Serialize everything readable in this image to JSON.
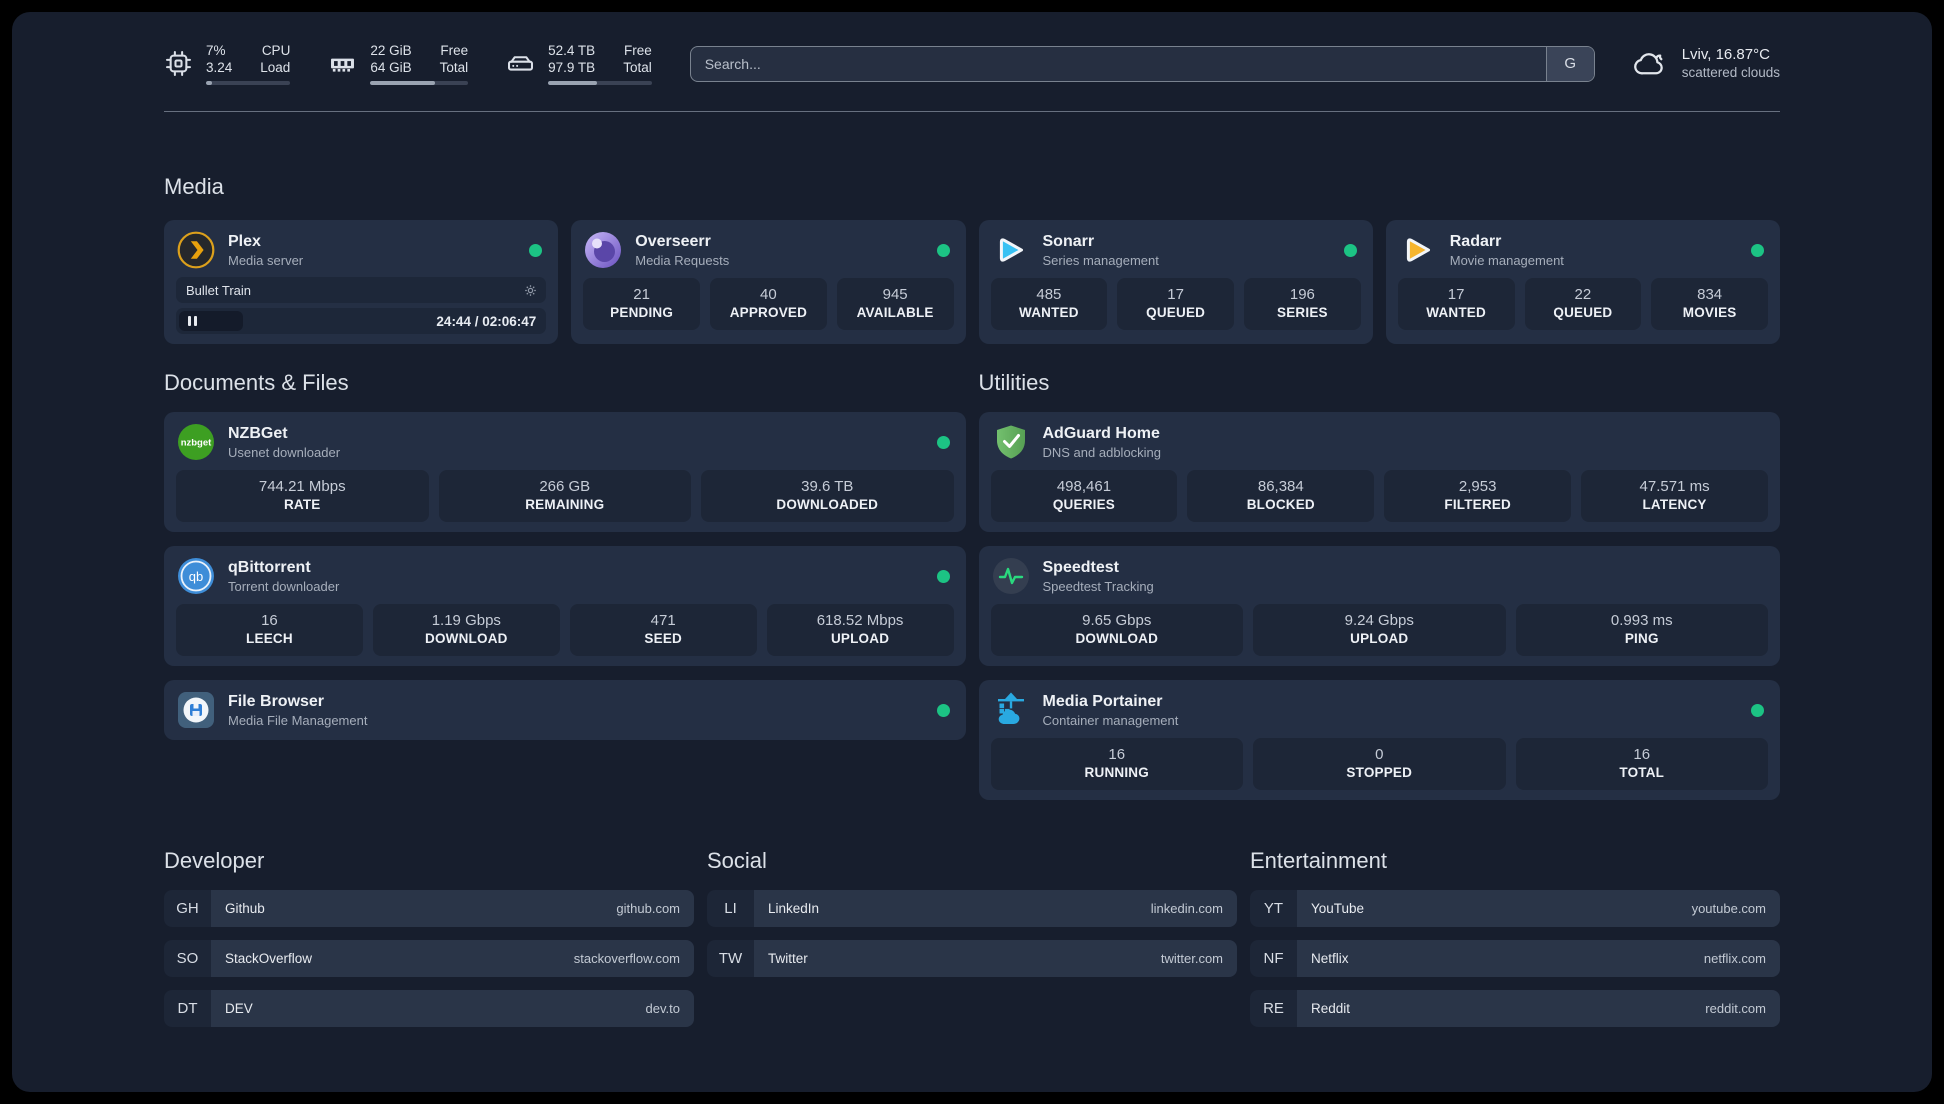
{
  "topbar": {
    "widgets": [
      {
        "icon": "cpu-icon",
        "value_top": "7%",
        "value_bottom": "3.24",
        "label_top": "CPU",
        "label_bottom": "Load",
        "progress": 7
      },
      {
        "icon": "memory-icon",
        "value_top": "22 GiB",
        "value_bottom": "64 GiB",
        "label_top": "Free",
        "label_bottom": "Total",
        "progress": 66
      },
      {
        "icon": "disk-icon",
        "value_top": "52.4 TB",
        "value_bottom": "97.9 TB",
        "label_top": "Free",
        "label_bottom": "Total",
        "progress": 47
      }
    ],
    "search": {
      "placeholder": "Search...",
      "button_label": "G"
    },
    "weather": {
      "icon": "cloud-icon",
      "location": "Lviv, 16.87°C",
      "condition": "scattered clouds"
    }
  },
  "media": {
    "heading": "Media",
    "plex": {
      "title": "Plex",
      "subtitle": "Media server",
      "status": "online",
      "now_playing": "Bullet Train",
      "time": "24:44 / 02:06:47"
    },
    "overseerr": {
      "title": "Overseerr",
      "subtitle": "Media Requests",
      "status": "online",
      "stats": [
        {
          "value": "21",
          "label": "PENDING"
        },
        {
          "value": "40",
          "label": "APPROVED"
        },
        {
          "value": "945",
          "label": "AVAILABLE"
        }
      ]
    },
    "sonarr": {
      "title": "Sonarr",
      "subtitle": "Series management",
      "status": "online",
      "stats": [
        {
          "value": "485",
          "label": "WANTED"
        },
        {
          "value": "17",
          "label": "QUEUED"
        },
        {
          "value": "196",
          "label": "SERIES"
        }
      ]
    },
    "radarr": {
      "title": "Radarr",
      "subtitle": "Movie management",
      "status": "online",
      "stats": [
        {
          "value": "17",
          "label": "WANTED"
        },
        {
          "value": "22",
          "label": "QUEUED"
        },
        {
          "value": "834",
          "label": "MOVIES"
        }
      ]
    }
  },
  "documents": {
    "heading": "Documents & Files",
    "nzbget": {
      "title": "NZBGet",
      "subtitle": "Usenet downloader",
      "status": "online",
      "stats": [
        {
          "value": "744.21 Mbps",
          "label": "RATE"
        },
        {
          "value": "266 GB",
          "label": "REMAINING"
        },
        {
          "value": "39.6 TB",
          "label": "DOWNLOADED"
        }
      ]
    },
    "qbittorrent": {
      "title": "qBittorrent",
      "subtitle": "Torrent downloader",
      "status": "online",
      "stats": [
        {
          "value": "16",
          "label": "LEECH"
        },
        {
          "value": "1.19 Gbps",
          "label": "DOWNLOAD"
        },
        {
          "value": "471",
          "label": "SEED"
        },
        {
          "value": "618.52 Mbps",
          "label": "UPLOAD"
        }
      ]
    },
    "filebrowser": {
      "title": "File Browser",
      "subtitle": "Media File Management",
      "status": "online"
    }
  },
  "utilities": {
    "heading": "Utilities",
    "adguard": {
      "title": "AdGuard Home",
      "subtitle": "DNS and adblocking",
      "stats": [
        {
          "value": "498,461",
          "label": "QUERIES"
        },
        {
          "value": "86,384",
          "label": "BLOCKED"
        },
        {
          "value": "2,953",
          "label": "FILTERED"
        },
        {
          "value": "47.571 ms",
          "label": "LATENCY"
        }
      ]
    },
    "speedtest": {
      "title": "Speedtest",
      "subtitle": "Speedtest Tracking",
      "stats": [
        {
          "value": "9.65 Gbps",
          "label": "DOWNLOAD"
        },
        {
          "value": "9.24 Gbps",
          "label": "UPLOAD"
        },
        {
          "value": "0.993 ms",
          "label": "PING"
        }
      ]
    },
    "portainer": {
      "title": "Media Portainer",
      "subtitle": "Container management",
      "status": "online",
      "stats": [
        {
          "value": "16",
          "label": "RUNNING"
        },
        {
          "value": "0",
          "label": "STOPPED"
        },
        {
          "value": "16",
          "label": "TOTAL"
        }
      ]
    }
  },
  "bookmarks": [
    {
      "heading": "Developer",
      "links": [
        {
          "abbr": "GH",
          "name": "Github",
          "url": "github.com"
        },
        {
          "abbr": "SO",
          "name": "StackOverflow",
          "url": "stackoverflow.com"
        },
        {
          "abbr": "DT",
          "name": "DEV",
          "url": "dev.to"
        }
      ]
    },
    {
      "heading": "Social",
      "links": [
        {
          "abbr": "LI",
          "name": "LinkedIn",
          "url": "linkedin.com"
        },
        {
          "abbr": "TW",
          "name": "Twitter",
          "url": "twitter.com"
        }
      ]
    },
    {
      "heading": "Entertainment",
      "links": [
        {
          "abbr": "YT",
          "name": "YouTube",
          "url": "youtube.com"
        },
        {
          "abbr": "NF",
          "name": "Netflix",
          "url": "netflix.com"
        },
        {
          "abbr": "RE",
          "name": "Reddit",
          "url": "reddit.com"
        }
      ]
    }
  ],
  "colors": {
    "status_online": "#1cc384",
    "plex_accent": "#e8a10d",
    "overseerr_accent": "#8b6fd8",
    "sonarr_accent": "#38c1f3",
    "radarr_accent": "#f6b52e",
    "nzbget_accent": "#3d9f22",
    "qbittorrent_accent": "#3e8dd8",
    "filebrowser_accent": "#2f7fd6",
    "adguard_accent": "#67b368",
    "speedtest_accent": "#2ad97e",
    "portainer_accent": "#29a9e1"
  }
}
